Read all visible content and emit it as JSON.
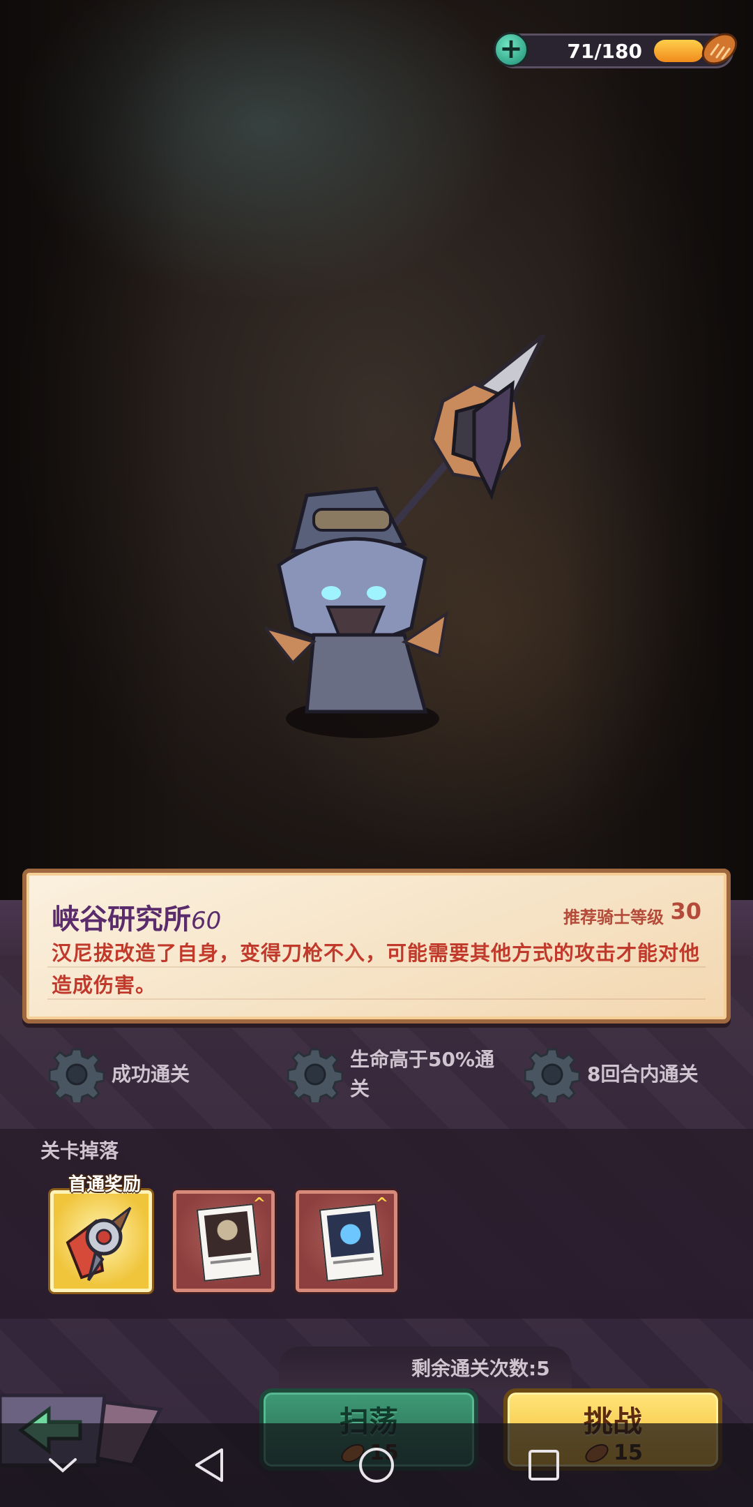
{
  "stamina": {
    "text": "71/180",
    "current": 71,
    "max": 180,
    "plus_icon": "plus-icon",
    "resource_icon": "bread-icon"
  },
  "stage": {
    "title": "峡谷研究所",
    "number": "60",
    "recommended_label": "推荐骑士等级",
    "recommended_level": "30",
    "description": "汉尼拔改造了自身，变得刀枪不入，可能需要其他方式的攻击才能对他造成伤害。"
  },
  "objectives": [
    {
      "icon": "gear-icon",
      "text": "成功通关"
    },
    {
      "icon": "gear-icon",
      "text": "生命高于50%通\n关"
    },
    {
      "icon": "gear-icon",
      "text": "8回合内通关"
    }
  ],
  "drops": {
    "label": "关卡掉落",
    "first_clear_badge": "首通奖励",
    "items": [
      {
        "type": "first-clear",
        "icon": "spear-emblem-icon"
      },
      {
        "type": "card",
        "icon": "photo-card-icon"
      },
      {
        "type": "card",
        "icon": "photo-card-icon"
      }
    ]
  },
  "bottom": {
    "remaining": "剩余通关次数:5",
    "sweep_label": "扫荡",
    "sweep_cost": "15",
    "challenge_label": "挑战",
    "challenge_cost": "15"
  },
  "colors": {
    "panel_border": "#a0683f",
    "title_purple": "#5b2c6c",
    "desc_red": "#c0392b",
    "sweep_green": "#2f8264",
    "challenge_gold": "#f4c43a"
  }
}
